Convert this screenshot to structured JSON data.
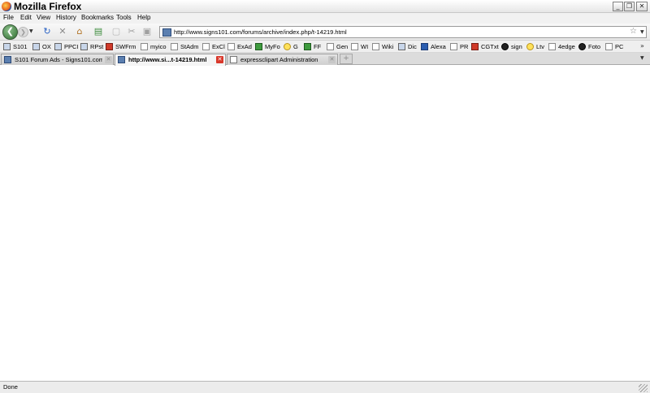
{
  "window": {
    "title": "Mozilla Firefox"
  },
  "menu": [
    "File",
    "Edit",
    "View",
    "History",
    "Bookmarks",
    "Tools",
    "Help"
  ],
  "address": {
    "url": "http://www.signs101.com/forums/archive/index.php/t-14219.html"
  },
  "bookmarks": [
    {
      "label": "S101",
      "icon": "site-icon"
    },
    {
      "label": "OX",
      "icon": "site-icon"
    },
    {
      "label": "PPCI",
      "icon": "site-icon"
    },
    {
      "label": "RPst",
      "icon": "site-icon"
    },
    {
      "label": "SWFrm",
      "icon": "flag-icon"
    },
    {
      "label": "myico",
      "icon": "page-icon"
    },
    {
      "label": "StAdm",
      "icon": "page-icon"
    },
    {
      "label": "ExCl",
      "icon": "page-icon"
    },
    {
      "label": "ExAd",
      "icon": "page-icon"
    },
    {
      "label": "MyFo",
      "icon": "myfonts-icon"
    },
    {
      "label": "G",
      "icon": "google-icon"
    },
    {
      "label": "FF",
      "icon": "site-icon"
    },
    {
      "label": "Gen",
      "icon": "page-icon"
    },
    {
      "label": "WI",
      "icon": "page-icon"
    },
    {
      "label": "Wiki",
      "icon": "wikipedia-icon"
    },
    {
      "label": "Dic",
      "icon": "site-icon"
    },
    {
      "label": "Alexa",
      "icon": "alexa-icon"
    },
    {
      "label": "PR",
      "icon": "page-icon"
    },
    {
      "label": "CGTxt",
      "icon": "cg-icon"
    },
    {
      "label": "sign",
      "icon": "sign-icon"
    },
    {
      "label": "Ltv",
      "icon": "bulb-icon"
    },
    {
      "label": "4edge",
      "icon": "page-icon"
    },
    {
      "label": "Foto",
      "icon": "foto-icon"
    },
    {
      "label": "PC",
      "icon": "page-icon"
    }
  ],
  "tabs": [
    {
      "label": "S101 Forum Ads - Signs101.com",
      "active": false
    },
    {
      "label": "http://www.si...t-14219.html",
      "active": true
    },
    {
      "label": "expressclipart Administration",
      "active": false
    }
  ],
  "status": {
    "text": "Done"
  }
}
